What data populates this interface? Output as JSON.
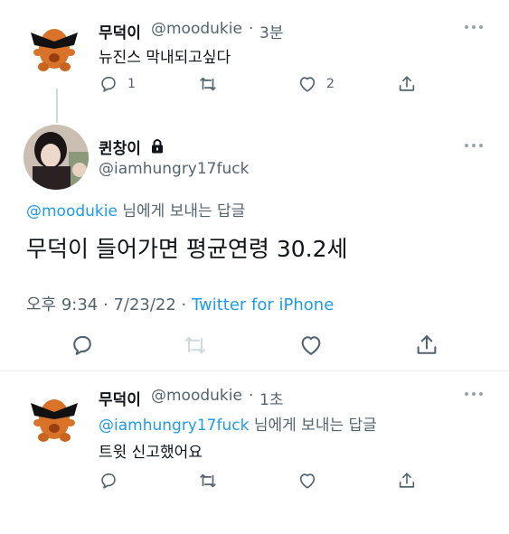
{
  "tweet1": {
    "display_name": "무덕이",
    "handle": "@moodukie",
    "separator": "·",
    "time": "3분",
    "text": "뉴진스 막내되고싶다",
    "reply_count": "1",
    "like_count": "2"
  },
  "main_tweet": {
    "display_name": "퀸창이",
    "handle": "@iamhungry17fuck",
    "reply_to_handle": "@moodukie",
    "reply_to_suffix": " 님에게 보내는 답글",
    "text": "무덕이 들어가면 평균연령 30.2세",
    "time": "오후 9:34",
    "dot1": " · ",
    "date": "7/23/22",
    "dot2": " · ",
    "source": "Twitter for iPhone"
  },
  "tweet3": {
    "display_name": "무덕이",
    "handle": "@moodukie",
    "separator": "·",
    "time": "1초",
    "reply_to_handle": "@iamhungry17fuck",
    "reply_to_suffix": " 님에게 보내는 답글",
    "text": "트윗 신고했어요"
  },
  "colors": {
    "accent": "#1d9bf0",
    "text_primary": "#0f1419",
    "text_secondary": "#536471",
    "divider": "#eff3f4",
    "retweet_disabled": "#cfd9de"
  },
  "icons": {
    "reply": "speech-bubble-icon",
    "retweet": "retweet-arrows-icon",
    "like": "heart-icon",
    "share": "share-upload-icon",
    "more": "more-dots-icon",
    "lock": "lock-icon"
  }
}
